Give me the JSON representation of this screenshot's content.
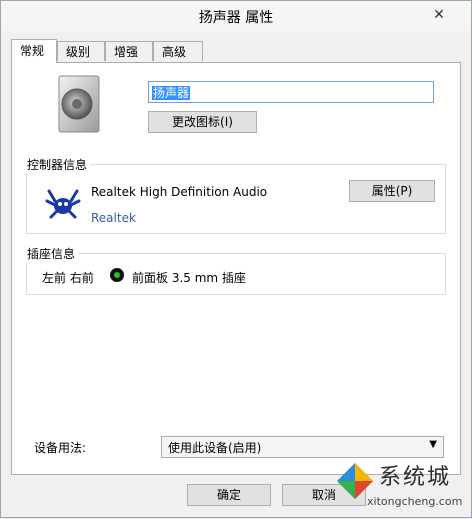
{
  "window": {
    "title": "扬声器 属性"
  },
  "tabs": [
    {
      "label": "常规",
      "active": true
    },
    {
      "label": "级别"
    },
    {
      "label": "增强"
    },
    {
      "label": "高级"
    }
  ],
  "general": {
    "device_name": "扬声器",
    "change_icon_label": "更改图标(I)",
    "controller": {
      "group_label": "控制器信息",
      "name": "Realtek High Definition Audio",
      "manufacturer": "Realtek",
      "properties_label": "属性(P)"
    },
    "jack": {
      "group_label": "插座信息",
      "position": "左前 右前",
      "description": "前面板 3.5 mm 插座",
      "color": "#1ec22a"
    },
    "usage": {
      "label": "设备用法:",
      "selected": "使用此设备(启用)"
    }
  },
  "footer": {
    "ok_label": "确定",
    "cancel_label": "取消"
  },
  "watermark": {
    "brand": "系统城",
    "url": "xitongcheng.com"
  }
}
